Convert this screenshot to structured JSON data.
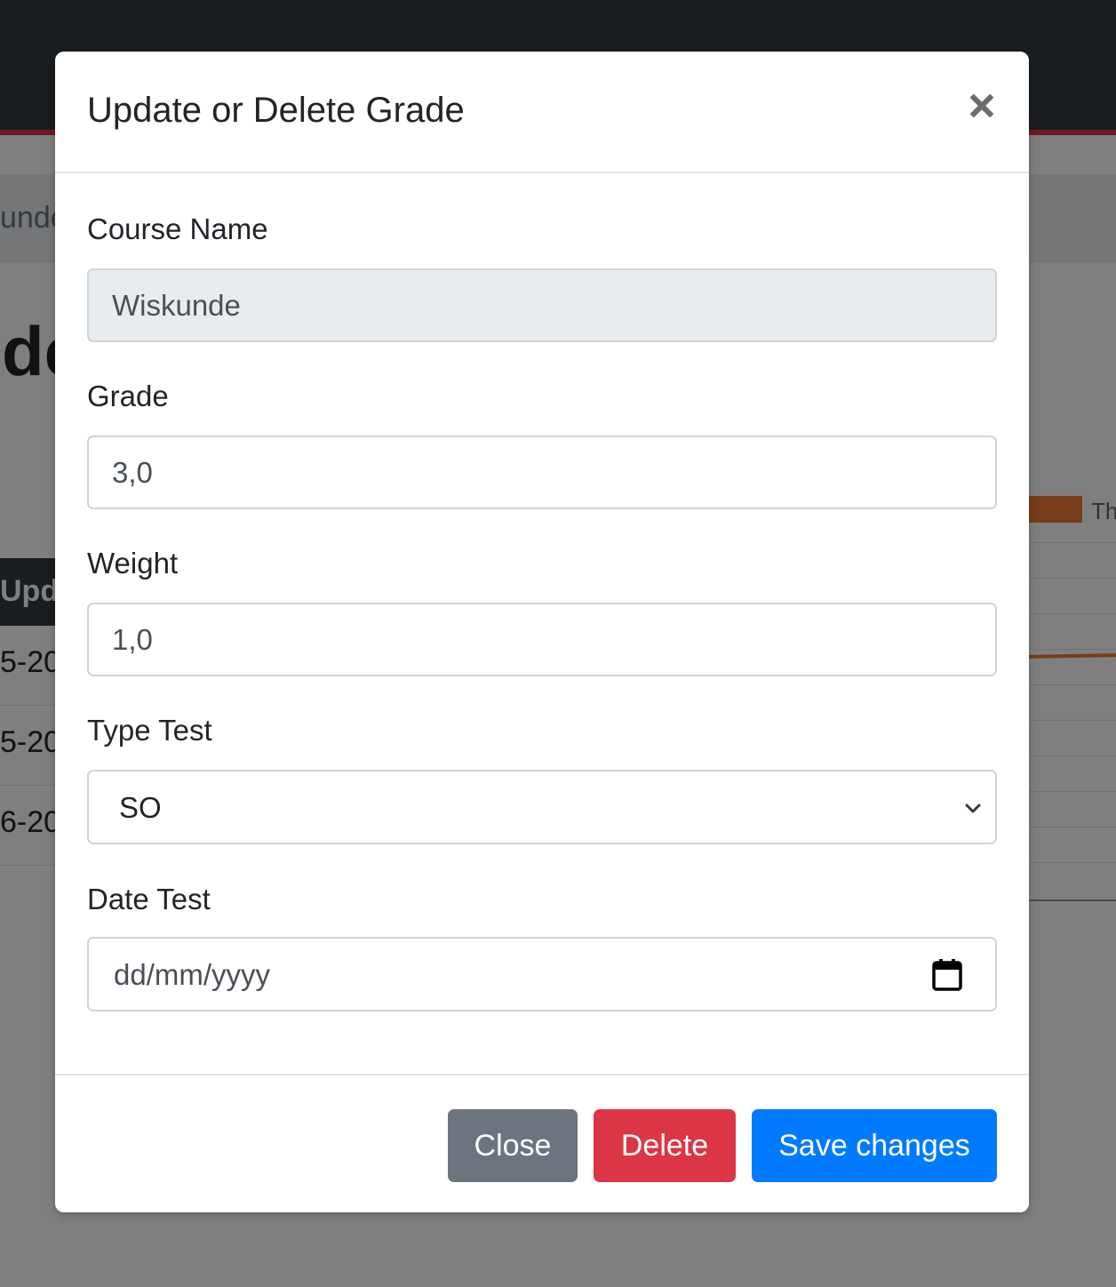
{
  "background": {
    "breadcrumb_text": "unde",
    "heading_text": "de",
    "table_header_text": "Upd",
    "table_rows": [
      "5-20",
      "5-20",
      "6-20"
    ],
    "chart_legend_text": "Th"
  },
  "modal": {
    "title": "Update or Delete Grade",
    "close_icon": "close-icon",
    "fields": {
      "course_name": {
        "label": "Course Name",
        "value": "Wiskunde"
      },
      "grade": {
        "label": "Grade",
        "value": "3,0"
      },
      "weight": {
        "label": "Weight",
        "value": "1,0"
      },
      "type_test": {
        "label": "Type Test",
        "selected": "SO"
      },
      "date_test": {
        "label": "Date Test",
        "placeholder": "dd/mm/yyyy"
      }
    },
    "buttons": {
      "close": "Close",
      "delete": "Delete",
      "save": "Save changes"
    }
  },
  "colors": {
    "navbar": "#343a40",
    "accent_red": "#dc3545",
    "secondary": "#6c757d",
    "primary": "#007bff",
    "chart_series": "#ed7d31"
  }
}
